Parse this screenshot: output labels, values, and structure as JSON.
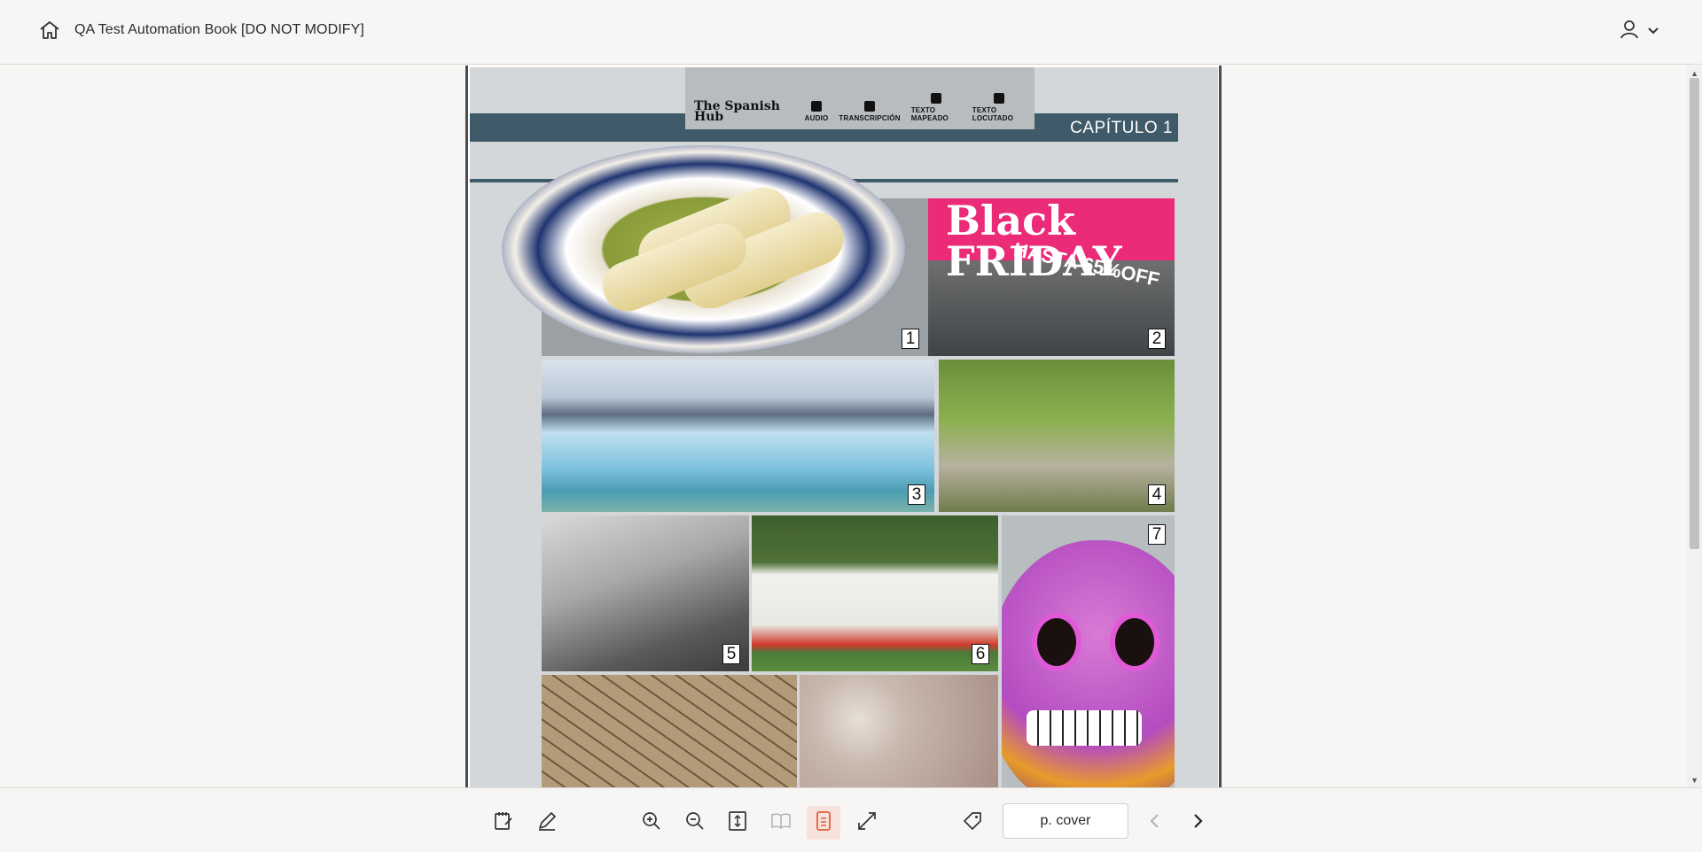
{
  "header": {
    "book_title": "QA Test Automation Book [DO NOT MODIFY]",
    "home_icon": "home-icon",
    "user_icon": "user-icon",
    "user_menu_icon": "chevron-down-icon"
  },
  "page": {
    "hub_logo": "The Spanish Hub",
    "tools": [
      {
        "label": "AUDIO",
        "icon": "speaker-icon"
      },
      {
        "label": "TRANSCRIPCIÓN",
        "icon": "copy-icon"
      },
      {
        "label": "TEXTO  MAPEADO",
        "icon": "marker-icon"
      },
      {
        "label": "TEXTO  LOCUTADO",
        "icon": "microphone-icon"
      }
    ],
    "chapter": "CAPÍTULO 1",
    "banner_text": "Black FRIDAY",
    "banner_sub": "HASTA 65%OFF",
    "photo_numbers": [
      "1",
      "2",
      "3",
      "4",
      "5",
      "6",
      "7"
    ]
  },
  "toolbar": {
    "page_label": "p. cover",
    "buttons": [
      {
        "name": "bookmarks-button",
        "icon": "notebook-icon"
      },
      {
        "name": "annotate-button",
        "icon": "pencil-icon"
      },
      {
        "name": "zoom-in-button",
        "icon": "zoom-in-icon"
      },
      {
        "name": "zoom-out-button",
        "icon": "zoom-out-icon"
      },
      {
        "name": "fit-page-button",
        "icon": "fit-height-icon"
      },
      {
        "name": "two-page-view-button",
        "icon": "open-book-icon"
      },
      {
        "name": "single-page-view-button",
        "icon": "single-page-icon"
      },
      {
        "name": "fullscreen-button",
        "icon": "expand-icon"
      },
      {
        "name": "tag-button",
        "icon": "tag-icon"
      },
      {
        "name": "previous-page-button",
        "icon": "chevron-left-icon"
      },
      {
        "name": "next-page-button",
        "icon": "chevron-right-icon"
      }
    ],
    "accent_color": "#e0603a"
  }
}
